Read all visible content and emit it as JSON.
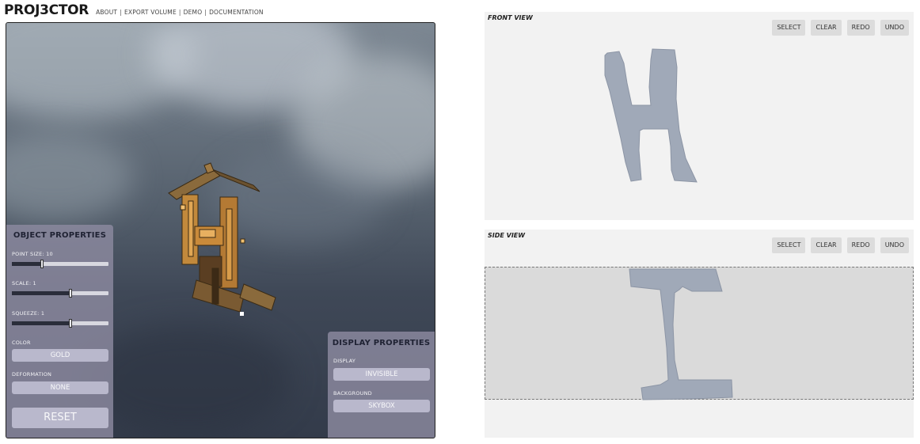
{
  "app": {
    "logo": "PROJ3CTOR",
    "nav": [
      {
        "label": "ABOUT"
      },
      {
        "label": "EXPORT VOLUME"
      },
      {
        "label": "DEMO"
      },
      {
        "label": "DOCUMENTATION"
      }
    ]
  },
  "object_properties": {
    "title": "OBJECT PROPERTIES",
    "point_size_label": "POINT SIZE: 10",
    "point_size_value": 10,
    "scale_label": "SCALE: 1",
    "scale_value": 1,
    "squeeze_label": "SQUEEZE: 1",
    "squeeze_value": 1,
    "color_label": "COLOR",
    "color_value": "GOLD",
    "deformation_label": "DEFORMATION",
    "deformation_value": "NONE",
    "reset_label": "RESET"
  },
  "display_properties": {
    "title": "DISPLAY PROPERTIES",
    "display_label": "DISPLAY",
    "display_value": "INVISIBLE",
    "background_label": "BACKGROUND",
    "background_value": "SKYBOX"
  },
  "front_view": {
    "title": "FRONT VIEW",
    "buttons": {
      "select": "SELECT",
      "clear": "CLEAR",
      "redo": "REDO",
      "undo": "UNDO"
    },
    "shape_letter": "H",
    "shape_color": "#a0a9b8"
  },
  "side_view": {
    "title": "SIDE VIEW",
    "buttons": {
      "select": "SELECT",
      "clear": "CLEAR",
      "redo": "REDO",
      "undo": "UNDO"
    },
    "shape_letter": "I",
    "shape_color": "#a0a9b8"
  },
  "colors": {
    "panel_bg": "#8c8aa0",
    "panel_button": "#b9b8cc",
    "view_bg": "#f2f2f2",
    "selection_bg": "#dadada",
    "object_gold": "#c98a3a"
  }
}
